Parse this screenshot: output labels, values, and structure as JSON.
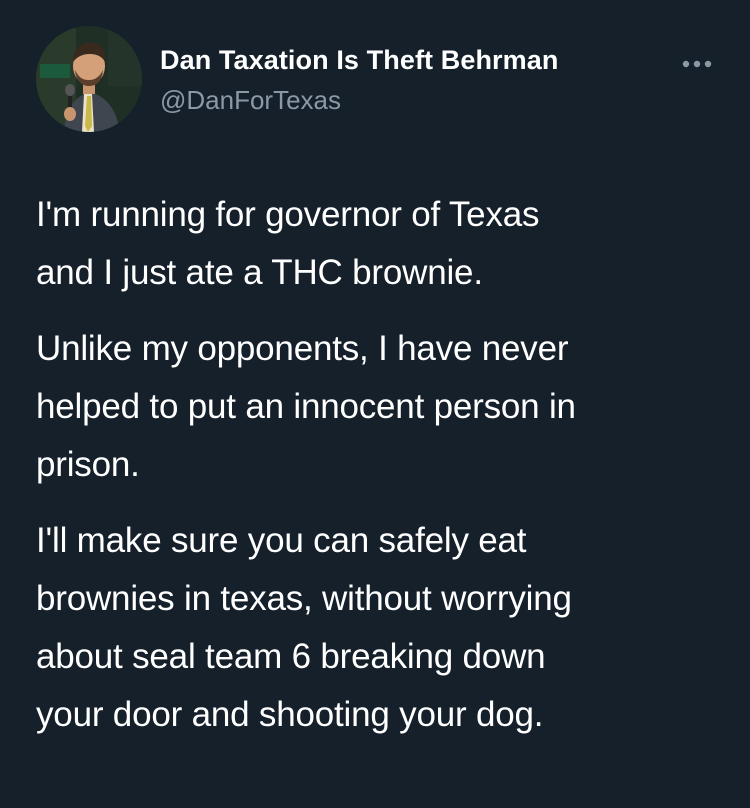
{
  "tweet": {
    "author": {
      "display_name": "Dan Taxation Is Theft Behrman",
      "handle": "@DanForTexas"
    },
    "more_icon": "more-horizontal-icon",
    "paragraphs": [
      [
        "I'm running for governor of Texas",
        "and I just ate a THC brownie."
      ],
      [
        "Unlike my opponents, I have never",
        "helped to put an innocent person in",
        "prison."
      ],
      [
        "I'll make sure you can safely eat",
        "brownies in texas, without worrying",
        "about seal team 6 breaking down",
        "your door and shooting your dog."
      ]
    ]
  },
  "colors": {
    "background": "#15202b",
    "text_primary": "#ffffff",
    "text_secondary": "#8b98a5"
  }
}
